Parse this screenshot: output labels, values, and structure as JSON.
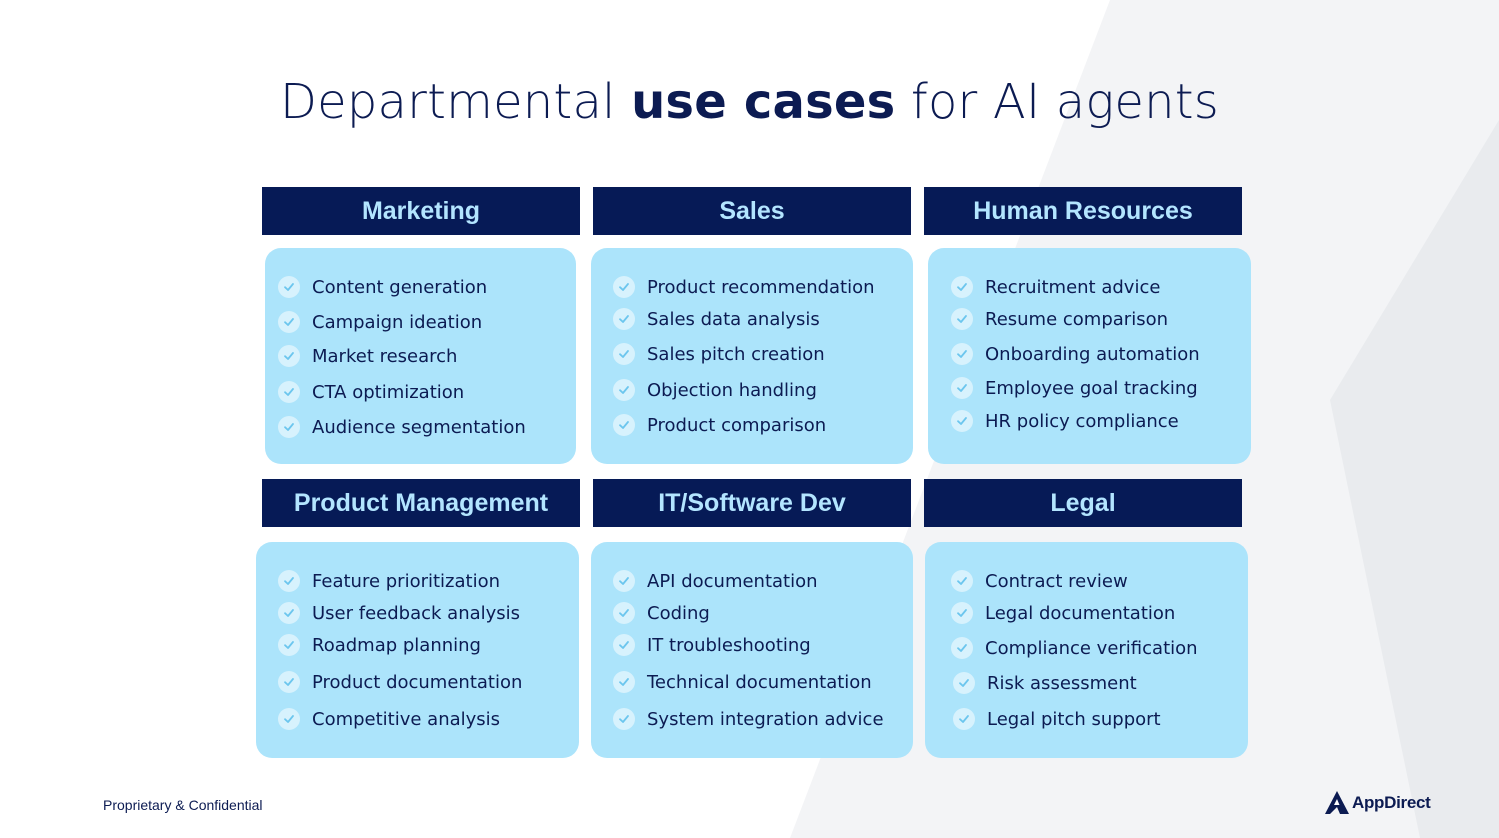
{
  "title": {
    "regular_1": "Departmental ",
    "bold": "use cases",
    "regular_2": " for AI agents"
  },
  "departments": [
    {
      "name": "Marketing",
      "items": [
        "Content generation",
        "Campaign ideation",
        "Market research",
        "CTA optimization",
        "Audience segmentation"
      ]
    },
    {
      "name": "Sales",
      "items": [
        "Product recommendation",
        "Sales data analysis",
        "Sales pitch creation",
        "Objection handling",
        "Product comparison"
      ]
    },
    {
      "name": "Human Resources",
      "items": [
        "Recruitment advice",
        "Resume comparison",
        "Onboarding automation",
        "Employee goal tracking",
        "HR policy compliance"
      ]
    },
    {
      "name": "Product Management",
      "items": [
        "Feature prioritization",
        "User feedback analysis",
        "Roadmap planning",
        "Product documentation",
        "Competitive analysis"
      ]
    },
    {
      "name": "IT/Software Dev",
      "items": [
        "API documentation",
        "Coding",
        "IT troubleshooting",
        "Technical documentation",
        "System integration advice"
      ]
    },
    {
      "name": "Legal",
      "items": [
        "Contract review",
        "Legal documentation",
        "Compliance verification",
        "Risk assessment",
        "Legal pitch support"
      ]
    }
  ],
  "footer": {
    "confidential": "Proprietary & Confidential",
    "logo_text": "AppDirect"
  },
  "icons": {
    "item_icon": "check-circle-icon",
    "logo_icon": "appdirect-logo-icon"
  },
  "colors": {
    "header_bg": "#061a56",
    "header_text": "#b3e5ff",
    "card_bg": "#ace4fb",
    "text": "#0c1b52"
  }
}
